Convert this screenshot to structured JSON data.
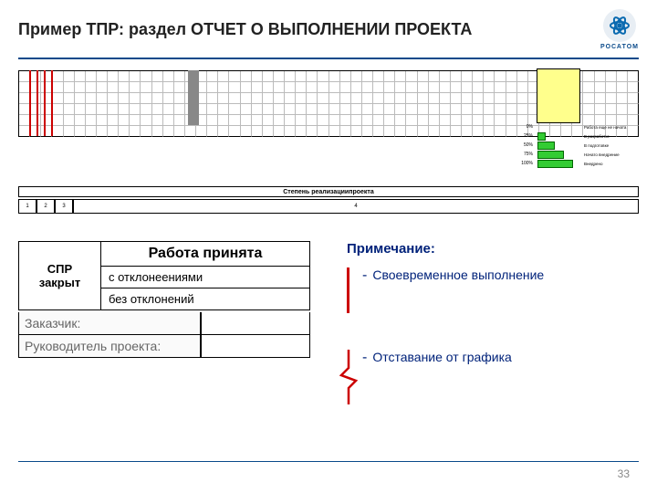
{
  "header": {
    "title": "Пример ТПР: раздел ОТЧЕТ О ВЫПОЛНЕНИИ ПРОЕКТА",
    "brand": "РОСАТОМ"
  },
  "sectionLabel": "Степень реализациипроекта",
  "numRow": {
    "n1": "1",
    "n2": "2",
    "n3": "3",
    "n4": "4"
  },
  "legend": {
    "rows": [
      {
        "pct": "0%",
        "label": "Работа еще не начата"
      },
      {
        "pct": "25%",
        "label": "В разработке"
      },
      {
        "pct": "50%",
        "label": "В подготовке"
      },
      {
        "pct": "75%",
        "label": "Начато внедрение"
      },
      {
        "pct": "100%",
        "label": "Внедрено"
      }
    ]
  },
  "accept": {
    "header": "Работа принята",
    "sprLabel": "СПР закрыт",
    "dev": "с отклонеениями",
    "nodev": "без отклонений",
    "customer": "Заказчик:",
    "pm": "Руководитель проекта:"
  },
  "notes": {
    "title": "Примечание:",
    "items": [
      "Своевременное выполнение",
      "Отставание от графика"
    ]
  },
  "chart_data": {
    "type": "table",
    "title": "Степень реализации проекта",
    "description": "Gantt-style progress grid with vertical markers and completion legend",
    "legend_scale": [
      {
        "pct": 0,
        "label": "Работа еще не начата"
      },
      {
        "pct": 25,
        "label": "В разработке"
      },
      {
        "pct": 50,
        "label": "В подготовке"
      },
      {
        "pct": 75,
        "label": "Начато внедрение"
      },
      {
        "pct": 100,
        "label": "Внедрено"
      }
    ],
    "red_markers_at_columns": [
      2,
      3,
      4,
      5
    ],
    "gray_block_column": 17
  },
  "pageNumber": "33"
}
